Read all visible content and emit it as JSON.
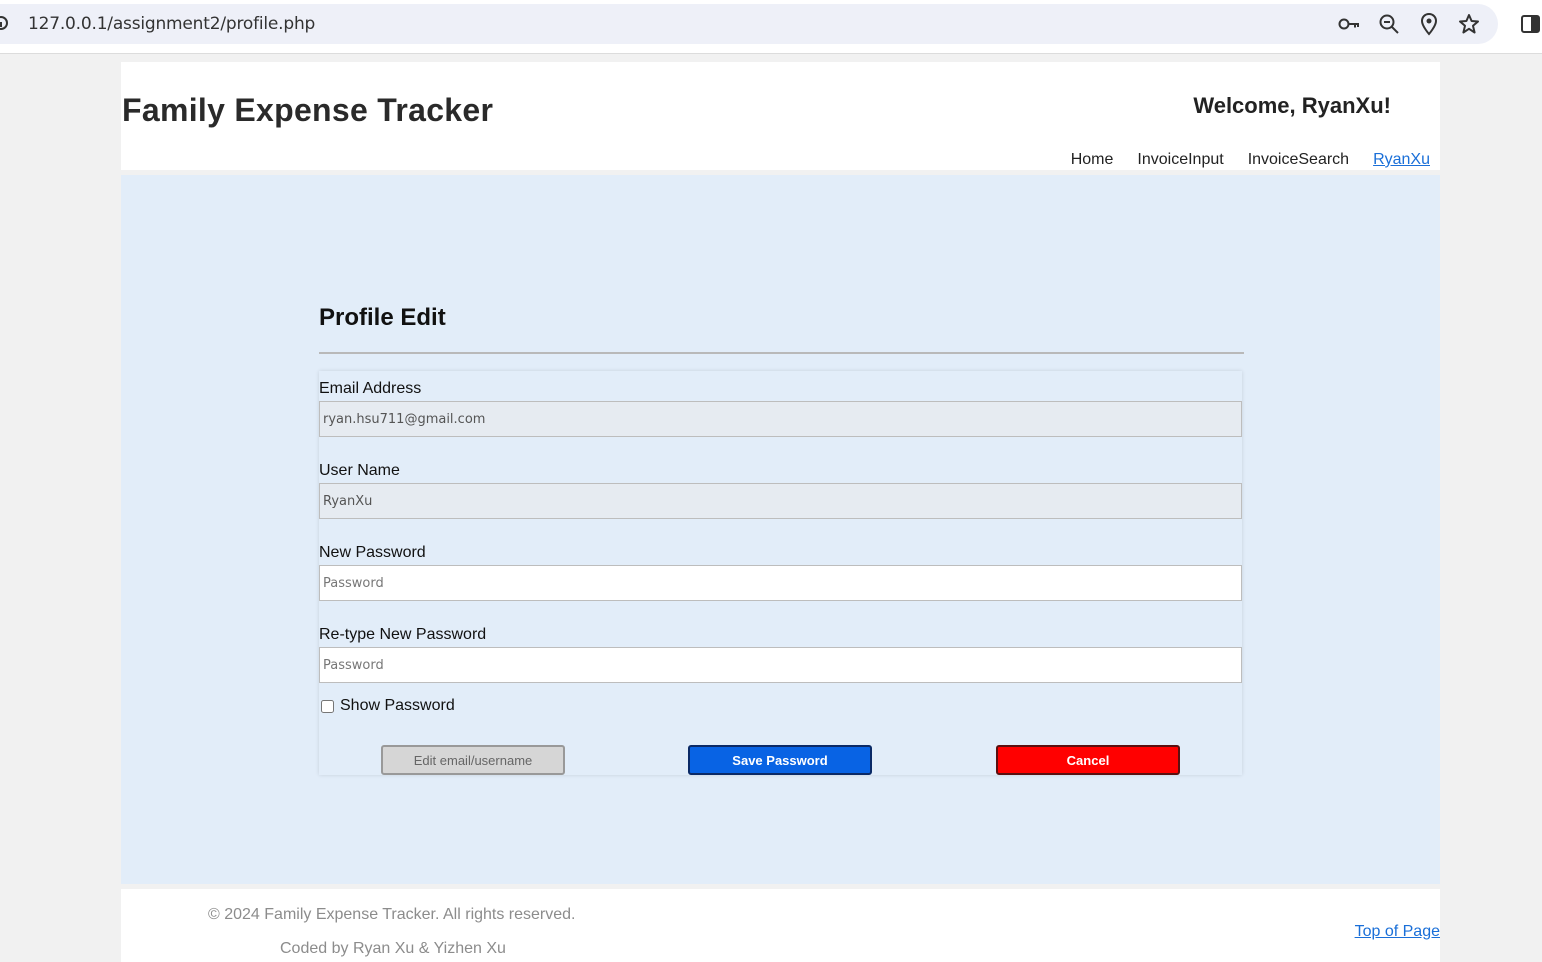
{
  "browser": {
    "url": "127.0.0.1/assignment2/profile.php",
    "icons": [
      "info-icon",
      "key-icon",
      "zoom-icon",
      "location-icon",
      "star-icon",
      "sidebar-icon"
    ]
  },
  "header": {
    "title": "Family Expense Tracker",
    "welcome": "Welcome, RyanXu!",
    "nav": [
      "Home",
      "InvoiceInput",
      "InvoiceSearch",
      "RyanXu"
    ]
  },
  "form": {
    "title": "Profile Edit",
    "email": {
      "label": "Email Address",
      "value": "ryan.hsu711@gmail.com"
    },
    "username": {
      "label": "User Name",
      "value": "RyanXu"
    },
    "new_password": {
      "label": "New Password",
      "placeholder": "Password"
    },
    "retype_password": {
      "label": "Re-type New Password",
      "placeholder": "Password"
    },
    "show_password": "Show Password",
    "buttons": {
      "edit": "Edit email/username",
      "save": "Save Password",
      "cancel": "Cancel"
    }
  },
  "footer": {
    "copyright": "© 2024 Family Expense Tracker. All rights reserved.",
    "coded_by": "Coded by Ryan Xu & Yizhen Xu",
    "top_link": "Top of Page"
  },
  "colors": {
    "main_bg": "#e2edf9",
    "accent_link": "#1a6fd8",
    "save_button": "#0863e4",
    "cancel_button": "#ff0000"
  }
}
